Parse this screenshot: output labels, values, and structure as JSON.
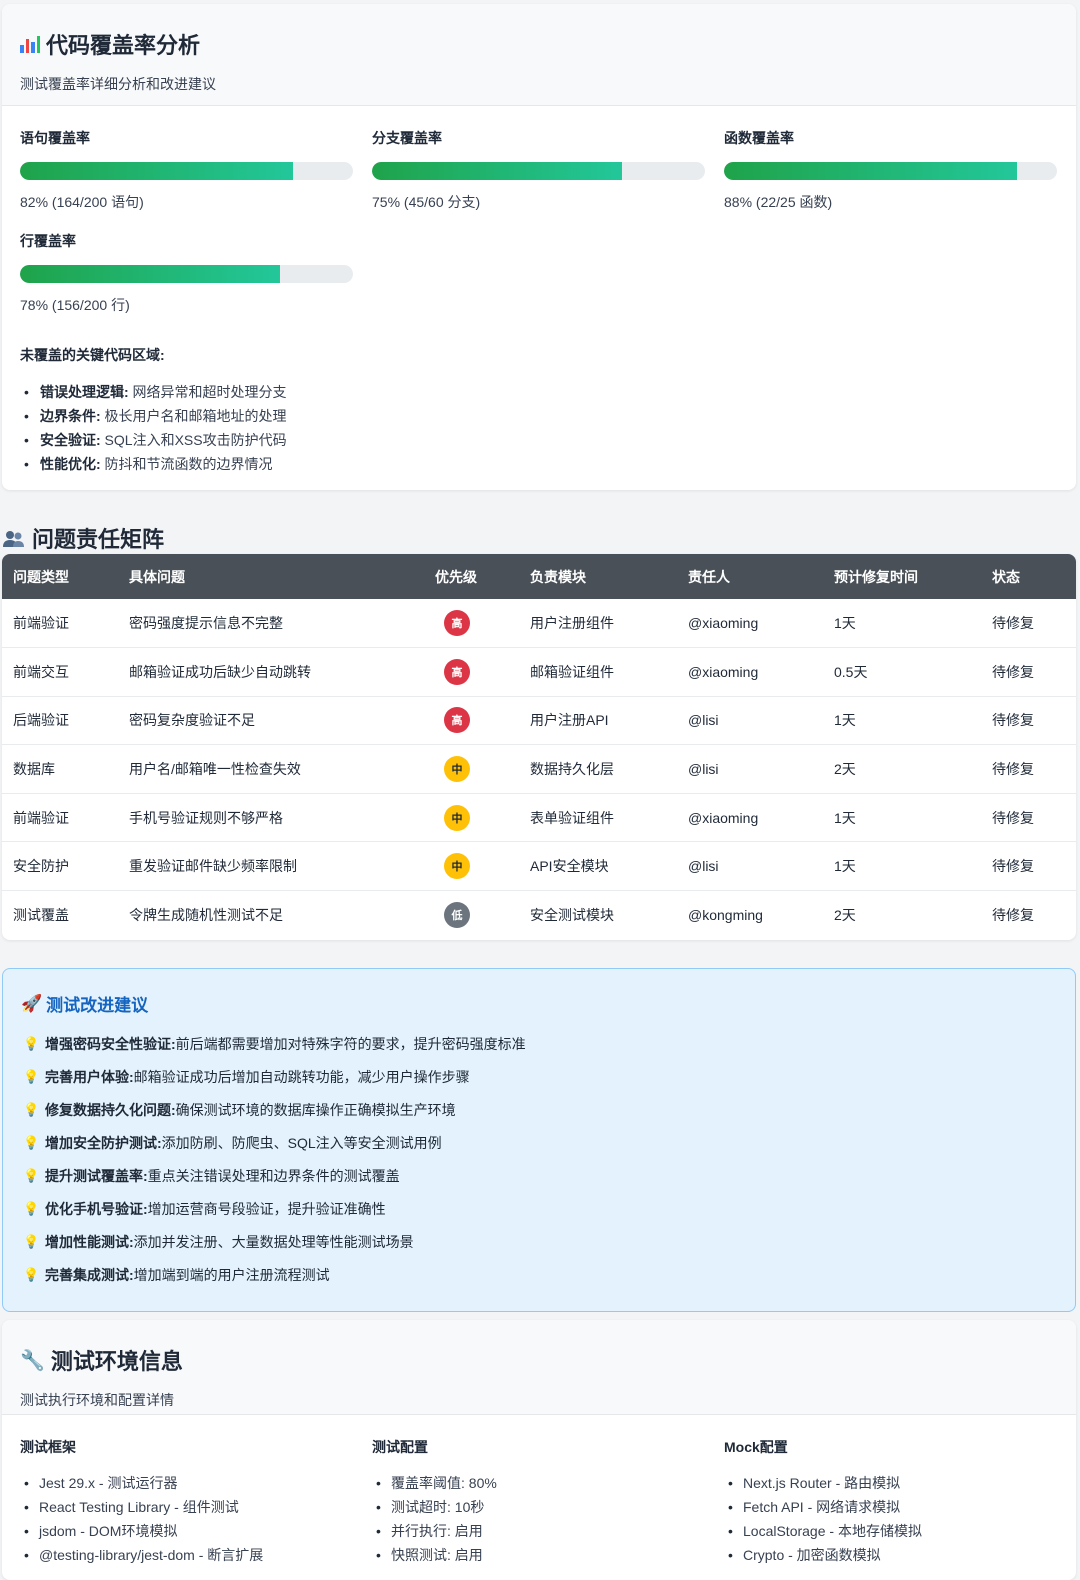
{
  "coverage": {
    "title": "代码覆盖率分析",
    "subtitle": "测试覆盖率详细分析和改进建议",
    "metrics": [
      {
        "label": "语句覆盖率",
        "percent": 82,
        "text": "82% (164/200 语句)"
      },
      {
        "label": "分支覆盖率",
        "percent": 75,
        "text": "75% (45/60 分支)"
      },
      {
        "label": "函数覆盖率",
        "percent": 88,
        "text": "88% (22/25 函数)"
      },
      {
        "label": "行覆盖率",
        "percent": 78,
        "text": "78% (156/200 行)"
      }
    ],
    "uncovered_title": "未覆盖的关键代码区域:",
    "uncovered": [
      {
        "term": "错误处理逻辑:",
        "desc": " 网络异常和超时处理分支"
      },
      {
        "term": "边界条件:",
        "desc": " 极长用户名和邮箱地址的处理"
      },
      {
        "term": "安全验证:",
        "desc": " SQL注入和XSS攻击防护代码"
      },
      {
        "term": "性能优化:",
        "desc": " 防抖和节流函数的边界情况"
      }
    ]
  },
  "matrix": {
    "title": "问题责任矩阵",
    "headers": [
      "问题类型",
      "具体问题",
      "优先级",
      "负责模块",
      "责任人",
      "预计修复时间",
      "状态"
    ],
    "rows": [
      {
        "type": "前端验证",
        "issue": "密码强度提示信息不完整",
        "priority": "高",
        "level": "high",
        "module": "用户注册组件",
        "owner": "@xiaoming",
        "eta": "1天",
        "status": "待修复"
      },
      {
        "type": "前端交互",
        "issue": "邮箱验证成功后缺少自动跳转",
        "priority": "高",
        "level": "high",
        "module": "邮箱验证组件",
        "owner": "@xiaoming",
        "eta": "0.5天",
        "status": "待修复"
      },
      {
        "type": "后端验证",
        "issue": "密码复杂度验证不足",
        "priority": "高",
        "level": "high",
        "module": "用户注册API",
        "owner": "@lisi",
        "eta": "1天",
        "status": "待修复"
      },
      {
        "type": "数据库",
        "issue": "用户名/邮箱唯一性检查失效",
        "priority": "中",
        "level": "mid",
        "module": "数据持久化层",
        "owner": "@lisi",
        "eta": "2天",
        "status": "待修复"
      },
      {
        "type": "前端验证",
        "issue": "手机号验证规则不够严格",
        "priority": "中",
        "level": "mid",
        "module": "表单验证组件",
        "owner": "@xiaoming",
        "eta": "1天",
        "status": "待修复"
      },
      {
        "type": "安全防护",
        "issue": "重发验证邮件缺少频率限制",
        "priority": "中",
        "level": "mid",
        "module": "API安全模块",
        "owner": "@lisi",
        "eta": "1天",
        "status": "待修复"
      },
      {
        "type": "测试覆盖",
        "issue": "令牌生成随机性测试不足",
        "priority": "低",
        "level": "low",
        "module": "安全测试模块",
        "owner": "@kongming",
        "eta": "2天",
        "status": "待修复"
      }
    ]
  },
  "suggestions": {
    "title": "测试改进建议",
    "items": [
      {
        "term": "增强密码安全性验证:",
        "desc": " 前后端都需要增加对特殊字符的要求，提升密码强度标准"
      },
      {
        "term": "完善用户体验:",
        "desc": " 邮箱验证成功后增加自动跳转功能，减少用户操作步骤"
      },
      {
        "term": "修复数据持久化问题:",
        "desc": " 确保测试环境的数据库操作正确模拟生产环境"
      },
      {
        "term": "增加安全防护测试:",
        "desc": " 添加防刷、防爬虫、SQL注入等安全测试用例"
      },
      {
        "term": "提升测试覆盖率:",
        "desc": " 重点关注错误处理和边界条件的测试覆盖"
      },
      {
        "term": "优化手机号验证:",
        "desc": " 增加运营商号段验证，提升验证准确性"
      },
      {
        "term": "增加性能测试:",
        "desc": " 添加并发注册、大量数据处理等性能测试场景"
      },
      {
        "term": "完善集成测试:",
        "desc": " 增加端到端的用户注册流程测试"
      }
    ]
  },
  "env": {
    "title": "测试环境信息",
    "subtitle": "测试执行环境和配置详情",
    "columns": [
      {
        "heading": "测试框架",
        "items": [
          "Jest 29.x - 测试运行器",
          "React Testing Library - 组件测试",
          "jsdom - DOM环境模拟",
          "@testing-library/jest-dom - 断言扩展"
        ]
      },
      {
        "heading": "测试配置",
        "items": [
          "覆盖率阈值: 80%",
          "测试超时: 10秒",
          "并行执行: 启用",
          "快照测试: 启用"
        ]
      },
      {
        "heading": "Mock配置",
        "items": [
          "Next.js Router - 路由模拟",
          "Fetch API - 网络请求模拟",
          "LocalStorage - 本地存储模拟",
          "Crypto - 加密函数模拟"
        ]
      }
    ]
  },
  "icons": {
    "coverage": "bar-chart-icon",
    "matrix": "people-icon",
    "suggestions": "rocket-icon",
    "suggestion_item": "lightbulb-icon",
    "env": "wrench-icon"
  },
  "colors": {
    "bar_start": "#1fa34a",
    "bar_end": "#22c79a",
    "priority_high": "#dc3545",
    "priority_mid": "#ffc107",
    "priority_low": "#6c757d",
    "table_header": "#495057",
    "suggest_bg": "#e3f2fd",
    "suggest_title": "#1565c0"
  }
}
